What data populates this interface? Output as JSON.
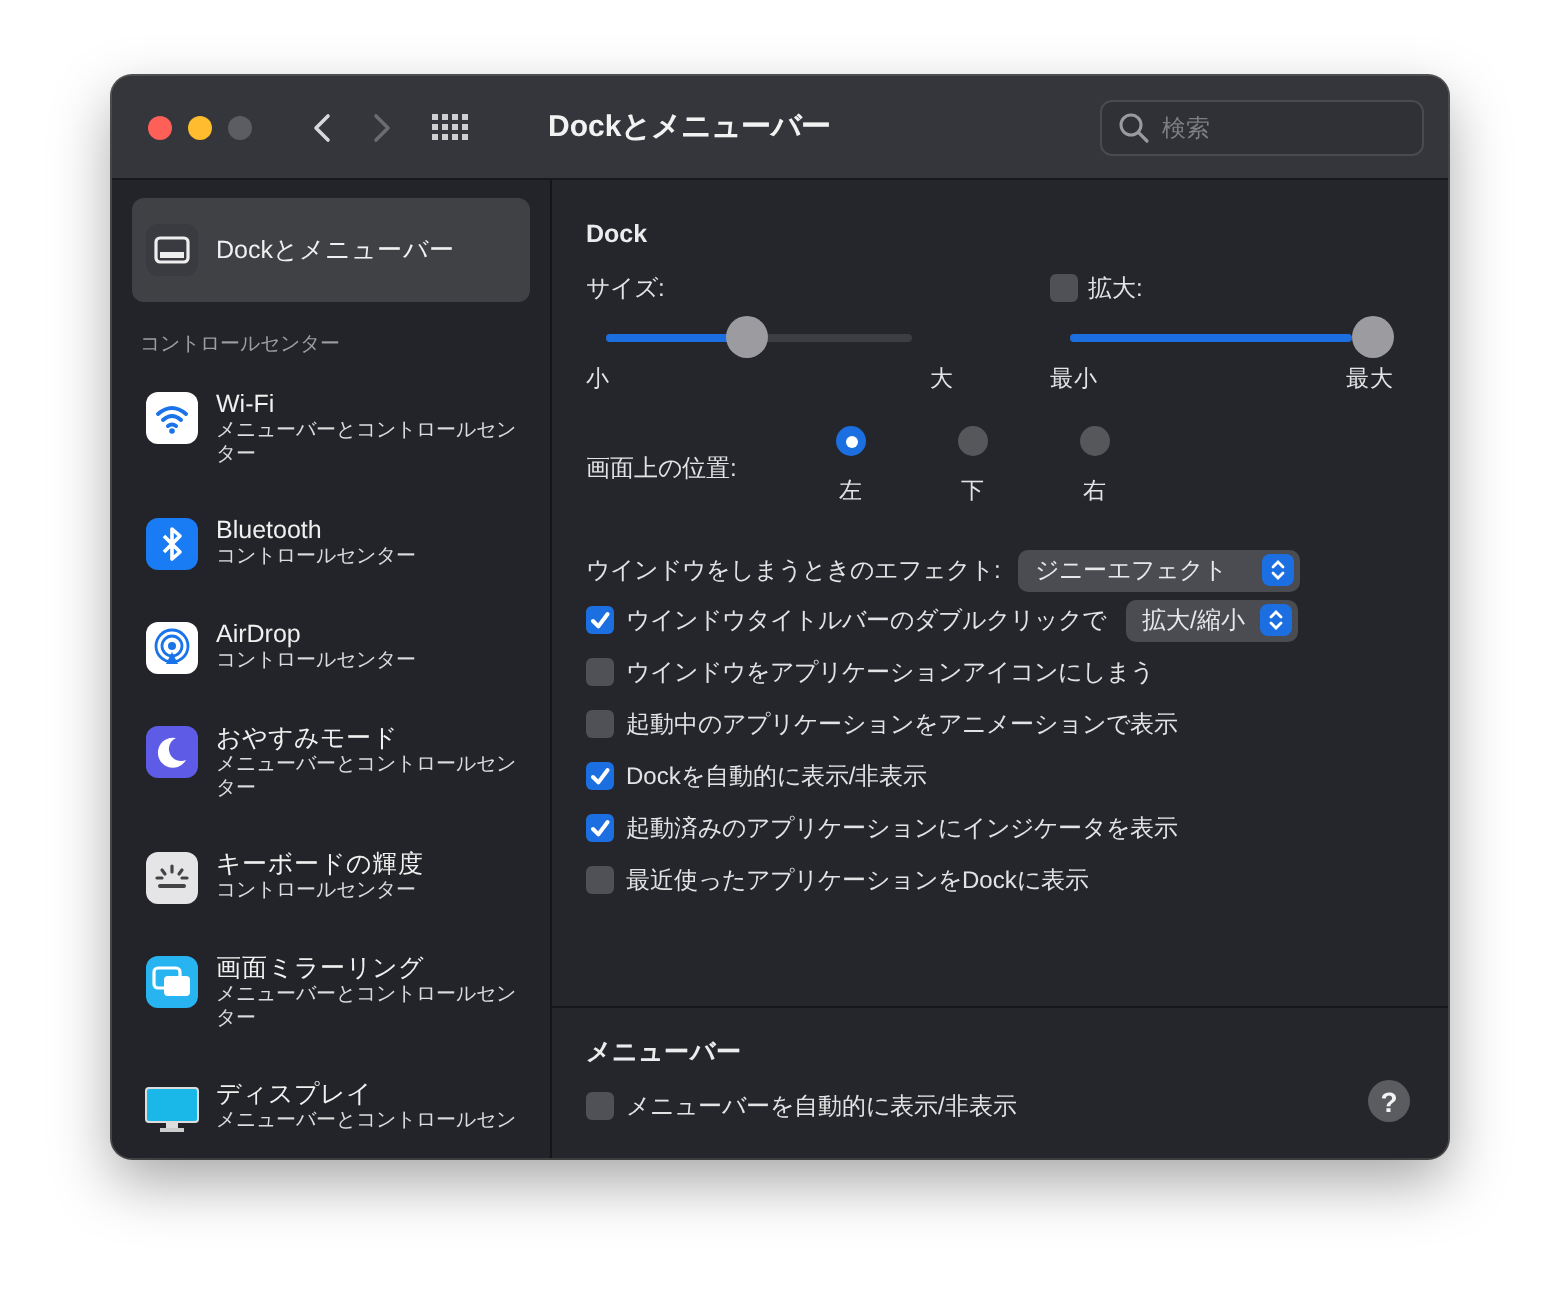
{
  "window": {
    "title": "Dockとメニューバー",
    "back_disabled": false,
    "forward_disabled": true
  },
  "search": {
    "placeholder": "検索"
  },
  "sidebar": {
    "items": [
      {
        "kind": "pane",
        "title": "Dockとメニューバー",
        "selected": true
      },
      {
        "kind": "header",
        "title": "コントロールセンター"
      },
      {
        "kind": "pane",
        "title": "Wi-Fi",
        "subtitle": "メニューバーとコントロールセンター",
        "selected": false
      },
      {
        "kind": "pane",
        "title": "Bluetooth",
        "subtitle": "コントロールセンター",
        "selected": false
      },
      {
        "kind": "pane",
        "title": "AirDrop",
        "subtitle": "コントロールセンター",
        "selected": false
      },
      {
        "kind": "pane",
        "title": "おやすみモード",
        "subtitle": "メニューバーとコントロールセンター",
        "selected": false
      },
      {
        "kind": "pane",
        "title": "キーボードの輝度",
        "subtitle": "コントロールセンター",
        "selected": false
      },
      {
        "kind": "pane",
        "title": "画面ミラーリング",
        "subtitle": "メニューバーとコントロールセンター",
        "selected": false
      },
      {
        "kind": "pane",
        "title": "ディスプレイ",
        "subtitle": "メニューバーとコントロールセン",
        "selected": false
      }
    ]
  },
  "dock": {
    "title": "Dock",
    "size": {
      "label": "サイズ:",
      "level": 0.43,
      "min_label": "小",
      "max_label": "大"
    },
    "magnification": {
      "label": "拡大:",
      "checked": false,
      "level": 1,
      "min_label": "最小",
      "max_label": "最大"
    },
    "position": {
      "label": "画面上の位置:",
      "options": [
        {
          "label": "左",
          "selected": true
        },
        {
          "label": "下",
          "selected": false
        },
        {
          "label": "右",
          "selected": false
        }
      ]
    },
    "effect": {
      "label": "ウインドウをしまうときのエフェクト:",
      "value": "ジニーエフェクト"
    },
    "options": [
      {
        "label": "ウインドウタイトルバーのダブルクリックで",
        "checked": true,
        "popup": "拡大/縮小"
      },
      {
        "label": "ウインドウをアプリケーションアイコンにしまう",
        "checked": false
      },
      {
        "label": "起動中のアプリケーションをアニメーションで表示",
        "checked": false
      },
      {
        "label": "Dockを自動的に表示/非表示",
        "checked": true
      },
      {
        "label": "起動済みのアプリケーションにインジケータを表示",
        "checked": true
      },
      {
        "label": "最近使ったアプリケーションをDockに表示",
        "checked": false
      }
    ]
  },
  "menubar": {
    "title": "メニューバー",
    "options": [
      {
        "label": "メニューバーを自動的に表示/非表示",
        "checked": false
      }
    ]
  },
  "help": "?"
}
